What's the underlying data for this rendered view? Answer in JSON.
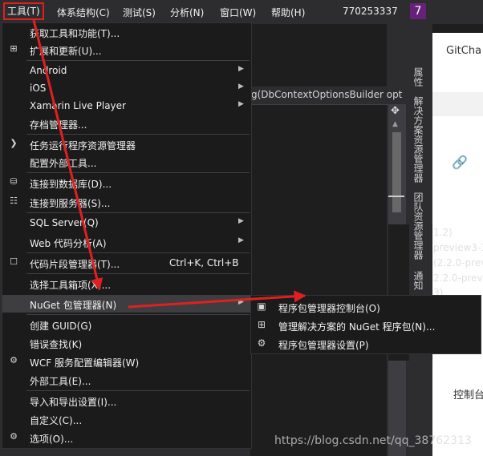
{
  "menubar": {
    "tools": "工具(T)",
    "architecture": "体系结构(C)",
    "test": "测试(S)",
    "analyze": "分析(N)",
    "window": "窗口(W)",
    "help": "帮助(H)",
    "account": "770253337",
    "badge": "7"
  },
  "editor": {
    "signature": "g(DbContextOptionsBuilder opt"
  },
  "side_tabs": {
    "properties": "属性",
    "solution_explorer": "解决方案资源管理器",
    "team_explorer": "团队资源管理器",
    "notifications": "通知"
  },
  "right_pane": {
    "gitchat": "GitCha",
    "r1": "1.2)",
    "r2": "preview3-35",
    "r3": "(2.2.0-previ",
    "r4": "2.2.0-previe",
    "r5": "3)",
    "r6": "控制台，",
    "link_icon": "link-icon"
  },
  "tools_menu": {
    "get_tools": "获取工具和功能(T)...",
    "extensions": "扩展和更新(U)...",
    "android": "Android",
    "ios": "iOS",
    "xamarin": "Xamarin Live Player",
    "archive": "存档管理器...",
    "task_runner": "任务运行程序资源管理器",
    "external_tools_config": "配置外部工具...",
    "connect_db": "连接到数据库(D)...",
    "connect_server": "连接到服务器(S)...",
    "sql_server": "SQL Server(Q)",
    "web_code_analysis": "Web 代码分析(A)",
    "snippets": "代码片段管理器(T)...",
    "snippets_shortcut": "Ctrl+K, Ctrl+B",
    "choose_toolbox": "选择工具箱项(X)...",
    "nuget": "NuGet 包管理器(N)",
    "create_guid": "创建 GUID(G)",
    "error_lookup": "错误查找(K)",
    "wcf": "WCF 服务配置编辑器(W)",
    "external_tools": "外部工具(E)...",
    "import_export": "导入和导出设置(I)...",
    "customize": "自定义(C)...",
    "options": "选项(O)..."
  },
  "nuget_submenu": {
    "console": "程序包管理器控制台(O)",
    "manage_solution": "管理解决方案的 NuGet 程序包(N)...",
    "settings": "程序包管理器设置(P)"
  },
  "watermark": "https://blog.csdn.net/qq_38762313",
  "colors": {
    "menu_bg": "#1b1b1c",
    "highlight": "#3e3e40",
    "annotation_red": "#e02020",
    "account_badge": "#68217a"
  }
}
